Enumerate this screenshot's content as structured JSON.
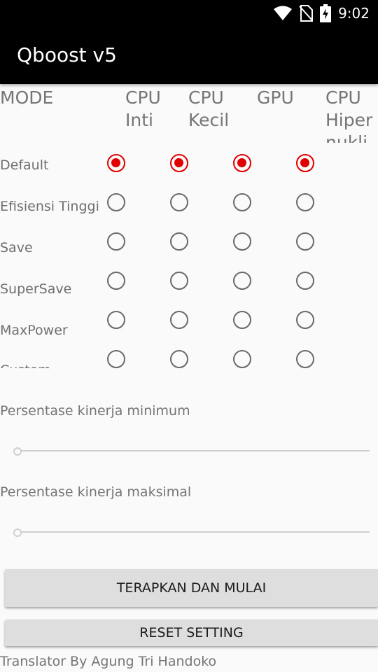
{
  "status_bar": {
    "time": "9:02",
    "icons": [
      "wifi-icon",
      "no-sim-icon",
      "battery-charging-icon"
    ]
  },
  "app": {
    "title": "Qboost v5"
  },
  "mode_table": {
    "mode_header": "MODE",
    "columns": [
      "CPU Inti",
      "CPU Kecil",
      "GPU",
      "CPU Hipernuklir"
    ],
    "rows": [
      {
        "label": "Default",
        "selected": [
          true,
          true,
          true,
          true
        ]
      },
      {
        "label": "Efisiensi Tinggi",
        "selected": [
          false,
          false,
          false,
          false
        ]
      },
      {
        "label": "Save",
        "selected": [
          false,
          false,
          false,
          false
        ]
      },
      {
        "label": "SuperSave",
        "selected": [
          false,
          false,
          false,
          false
        ]
      },
      {
        "label": "MaxPower",
        "selected": [
          false,
          false,
          false,
          false
        ]
      },
      {
        "label": "Custom",
        "selected": [
          false,
          false,
          false,
          false
        ]
      }
    ]
  },
  "seekbars": {
    "min_label": "Persentase kinerja minimum",
    "min_value": 0,
    "max_label": "Persentase kinerja maksimal",
    "max_value": 0
  },
  "buttons": {
    "apply_label": "TERAPKAN DAN MULAI",
    "reset_label": "RESET SETTING"
  },
  "footer": {
    "credit": "Translator By Agung Tri Handoko"
  },
  "colors": {
    "accent": "#e10000",
    "appbar": "#000000",
    "background": "#fafafa"
  }
}
